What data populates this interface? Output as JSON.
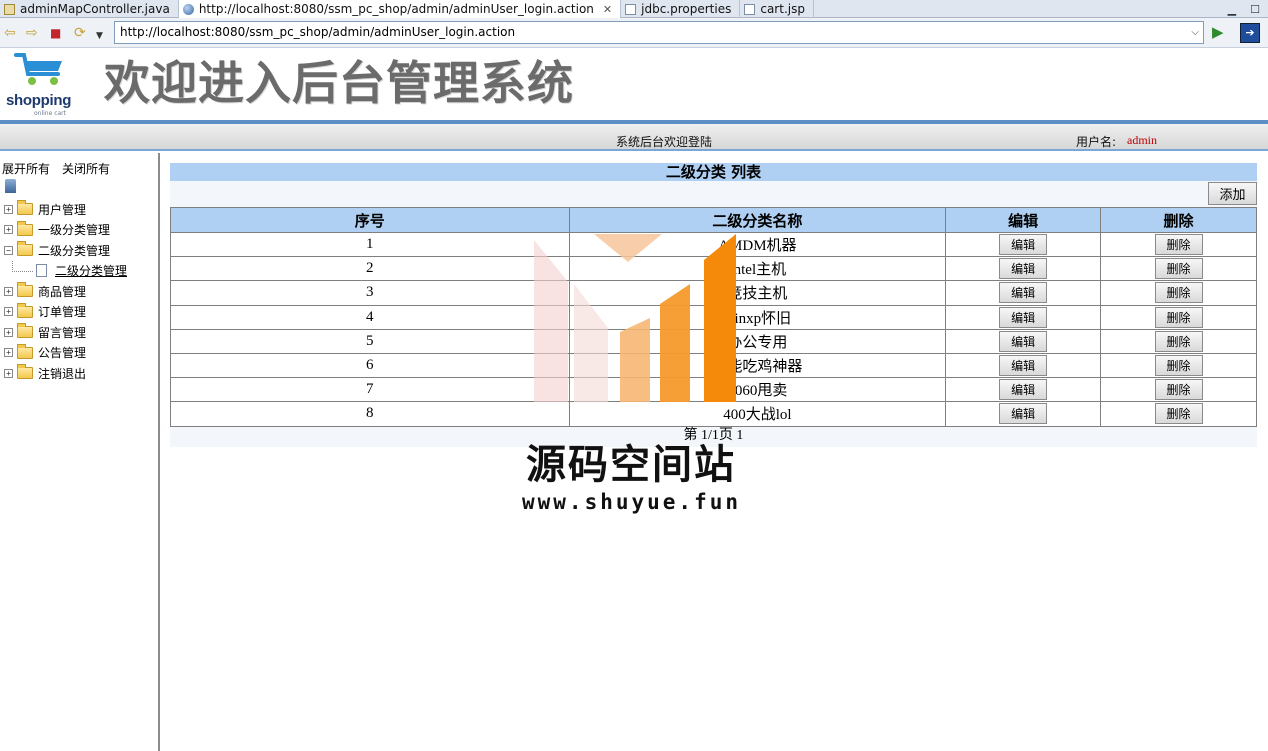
{
  "browser": {
    "tabs": [
      {
        "label": "adminMapController.java",
        "icon": "java-file-icon"
      },
      {
        "label": "http://localhost:8080/ssm_pc_shop/admin/adminUser_login.action",
        "icon": "globe-icon"
      },
      {
        "label": "jdbc.properties",
        "icon": "file-icon"
      },
      {
        "label": "cart.jsp",
        "icon": "file-icon"
      }
    ],
    "address": "http://localhost:8080/ssm_pc_shop/admin/adminUser_login.action"
  },
  "header": {
    "logo_text": "shopping",
    "logo_sub": "online cart",
    "title": "欢迎进入后台管理系统",
    "welcome": "系统后台欢迎登陆",
    "user_label": "用户名:",
    "user_name": "admin",
    "accent_color": "#5d8fc4"
  },
  "sidebar": {
    "expand_all": "展开所有",
    "collapse_all": "关闭所有",
    "items": [
      {
        "label": "用户管理",
        "toggle": "+"
      },
      {
        "label": "一级分类管理",
        "toggle": "+"
      },
      {
        "label": "二级分类管理",
        "toggle": "−"
      },
      {
        "label": "二级分类管理",
        "child": true
      },
      {
        "label": "商品管理",
        "toggle": "+"
      },
      {
        "label": "订单管理",
        "toggle": "+"
      },
      {
        "label": "留言管理",
        "toggle": "+"
      },
      {
        "label": "公告管理",
        "toggle": "+"
      },
      {
        "label": "注销退出",
        "toggle": "+"
      }
    ]
  },
  "main": {
    "title": "二级分类 列表",
    "add_label": "添加",
    "columns": [
      "序号",
      "二级分类名称",
      "编辑",
      "删除"
    ],
    "edit_label": "编辑",
    "delete_label": "删除",
    "rows": [
      {
        "no": "1",
        "name": "AMDM机器"
      },
      {
        "no": "2",
        "name": "Intel主机"
      },
      {
        "no": "3",
        "name": "竞技主机"
      },
      {
        "no": "4",
        "name": "winxp怀旧"
      },
      {
        "no": "5",
        "name": "办公专用"
      },
      {
        "no": "6",
        "name": "高能吃鸡神器"
      },
      {
        "no": "7",
        "name": "1060甩卖"
      },
      {
        "no": "8",
        "name": "400大战lol"
      }
    ],
    "pager": "第 1/1页 1"
  },
  "watermark": {
    "title": "源码空间站",
    "url": "www.shuyue.fun"
  }
}
